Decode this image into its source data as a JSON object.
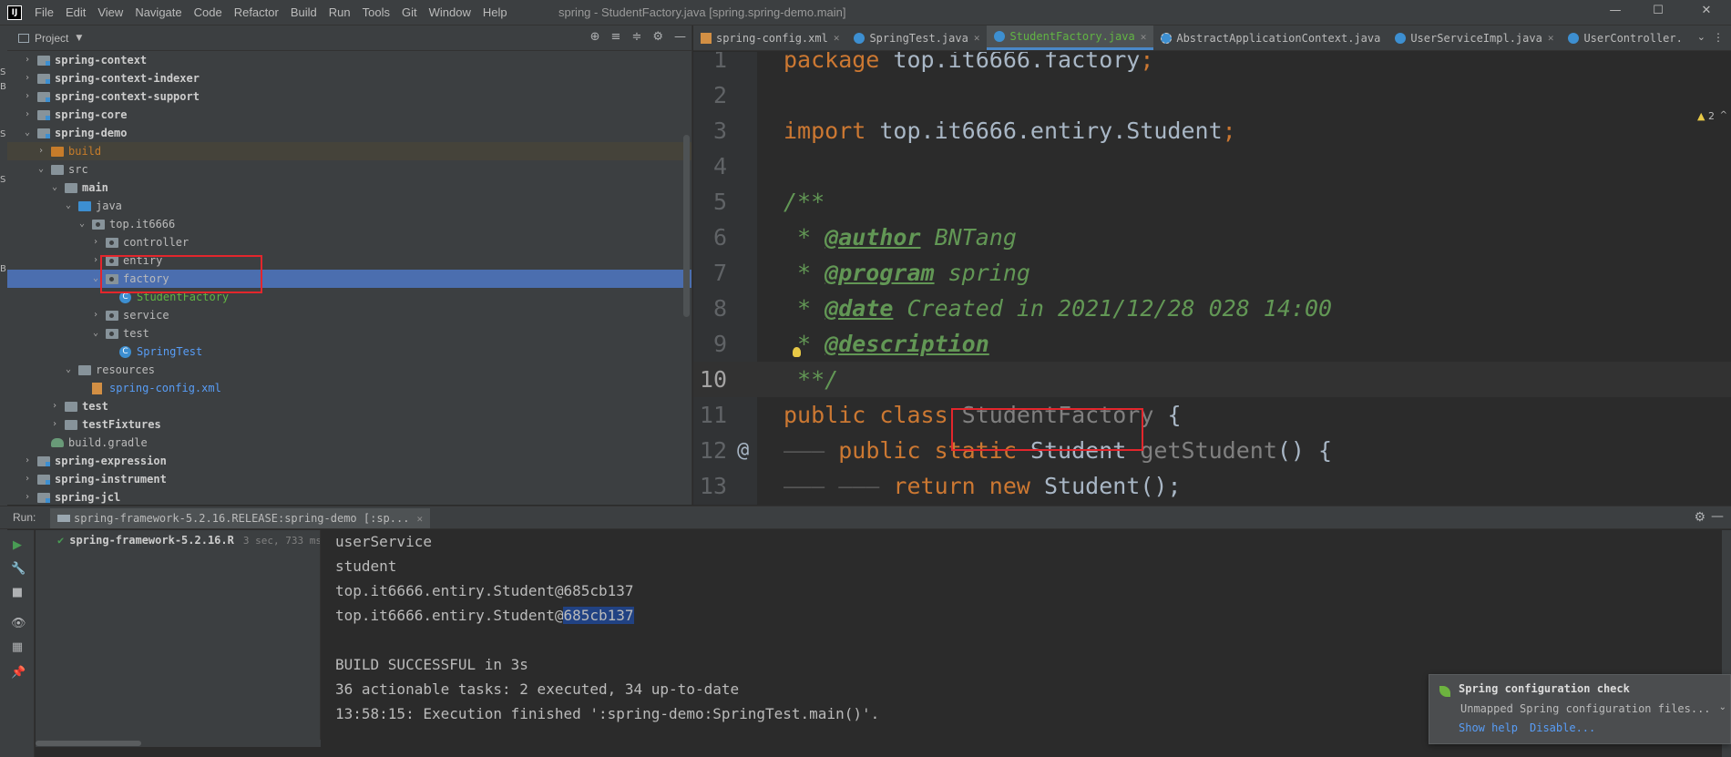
{
  "app": {
    "logo": "IJ",
    "window_title": "spring - StudentFactory.java [spring.spring-demo.main]",
    "controls": {
      "minimize": "—",
      "maximize": "☐",
      "close": "✕"
    }
  },
  "menu": [
    "File",
    "Edit",
    "View",
    "Navigate",
    "Code",
    "Refactor",
    "Build",
    "Run",
    "Tools",
    "Git",
    "Window",
    "Help"
  ],
  "left_strip": [
    "S",
    "B",
    "S",
    "S",
    "B"
  ],
  "project_panel": {
    "title": "Project",
    "tools": [
      "⊕",
      "≡",
      "≑",
      "⚙",
      "—"
    ],
    "tree": [
      {
        "label": "spring-context",
        "depth": 0,
        "arrow": "›",
        "icon": "module",
        "style": "bold"
      },
      {
        "label": "spring-context-indexer",
        "depth": 0,
        "arrow": "›",
        "icon": "module",
        "style": "bold"
      },
      {
        "label": "spring-context-support",
        "depth": 0,
        "arrow": "›",
        "icon": "module",
        "style": "bold"
      },
      {
        "label": "spring-core",
        "depth": 0,
        "arrow": "›",
        "icon": "module",
        "style": "bold"
      },
      {
        "label": "spring-demo",
        "depth": 0,
        "arrow": "⌄",
        "icon": "module",
        "style": "bold"
      },
      {
        "label": "build",
        "depth": 1,
        "arrow": "›",
        "icon": "folder-orange",
        "style": "orange",
        "excluded": true
      },
      {
        "label": "src",
        "depth": 1,
        "arrow": "⌄",
        "icon": "folder",
        "style": "plain"
      },
      {
        "label": "main",
        "depth": 2,
        "arrow": "⌄",
        "icon": "folder",
        "style": "bold"
      },
      {
        "label": "java",
        "depth": 3,
        "arrow": "⌄",
        "icon": "folder-java",
        "style": "plain"
      },
      {
        "label": "top.it6666",
        "depth": 4,
        "arrow": "⌄",
        "icon": "package",
        "style": "plain"
      },
      {
        "label": "controller",
        "depth": 5,
        "arrow": "›",
        "icon": "package",
        "style": "plain"
      },
      {
        "label": "entiry",
        "depth": 5,
        "arrow": "›",
        "icon": "package",
        "style": "plain"
      },
      {
        "label": "factory",
        "depth": 5,
        "arrow": "⌄",
        "icon": "package",
        "style": "plain",
        "selected": true
      },
      {
        "label": "StudentFactory",
        "depth": 6,
        "arrow": "",
        "icon": "class",
        "style": "green"
      },
      {
        "label": "service",
        "depth": 5,
        "arrow": "›",
        "icon": "package",
        "style": "plain"
      },
      {
        "label": "test",
        "depth": 5,
        "arrow": "⌄",
        "icon": "package",
        "style": "plain"
      },
      {
        "label": "SpringTest",
        "depth": 6,
        "arrow": "",
        "icon": "class",
        "style": "blue"
      },
      {
        "label": "resources",
        "depth": 3,
        "arrow": "⌄",
        "icon": "folder-res",
        "style": "plain"
      },
      {
        "label": "spring-config.xml",
        "depth": 4,
        "arrow": "",
        "icon": "xml",
        "style": "blue"
      },
      {
        "label": "test",
        "depth": 2,
        "arrow": "›",
        "icon": "folder",
        "style": "bold"
      },
      {
        "label": "testFixtures",
        "depth": 2,
        "arrow": "›",
        "icon": "folder",
        "style": "bold"
      },
      {
        "label": "build.gradle",
        "depth": 1,
        "arrow": "",
        "icon": "gradle",
        "style": "plain"
      },
      {
        "label": "spring-expression",
        "depth": 0,
        "arrow": "›",
        "icon": "module",
        "style": "bold"
      },
      {
        "label": "spring-instrument",
        "depth": 0,
        "arrow": "›",
        "icon": "module",
        "style": "bold"
      },
      {
        "label": "spring-jcl",
        "depth": 0,
        "arrow": "›",
        "icon": "module",
        "style": "bold"
      }
    ]
  },
  "tabs": [
    {
      "name": "spring-config.xml",
      "icon": "xml",
      "style": "plain"
    },
    {
      "name": "SpringTest.java",
      "icon": "class",
      "style": "plain"
    },
    {
      "name": "StudentFactory.java",
      "icon": "class",
      "style": "active",
      "active": true
    },
    {
      "name": "AbstractApplicationContext.java",
      "icon": "abstract",
      "style": "plain"
    },
    {
      "name": "UserServiceImpl.java",
      "icon": "class",
      "style": "plain"
    },
    {
      "name": "UserController.",
      "icon": "class",
      "style": "plain"
    }
  ],
  "tab_overflow": "⌄",
  "tab_menu": "⋮",
  "editor": {
    "warnings": "2",
    "lines": [
      {
        "n": "1",
        "tokens": [
          [
            "kw",
            "package "
          ],
          [
            "p",
            "top.it6666.factory"
          ],
          [
            "kw",
            ";"
          ]
        ]
      },
      {
        "n": "2",
        "tokens": []
      },
      {
        "n": "3",
        "tokens": [
          [
            "kw",
            "import "
          ],
          [
            "p",
            "top.it6666.entiry.Student"
          ],
          [
            "kw",
            ";"
          ]
        ]
      },
      {
        "n": "4",
        "tokens": []
      },
      {
        "n": "5",
        "tokens": [
          [
            "doc",
            "/**"
          ]
        ]
      },
      {
        "n": "6",
        "tokens": [
          [
            "doc",
            " * "
          ],
          [
            "doctag",
            "@author"
          ],
          [
            "doc",
            " BNTang"
          ]
        ]
      },
      {
        "n": "7",
        "tokens": [
          [
            "doc",
            " * "
          ],
          [
            "doctag",
            "@program"
          ],
          [
            "doc",
            " spring"
          ]
        ]
      },
      {
        "n": "8",
        "tokens": [
          [
            "doc",
            " * "
          ],
          [
            "doctag",
            "@date"
          ],
          [
            "doc",
            " Created in 2021/12/28 028 14:00"
          ]
        ]
      },
      {
        "n": "9",
        "tokens": [
          [
            "doc",
            " * "
          ],
          [
            "doctag",
            "@description"
          ]
        ]
      },
      {
        "n": "10",
        "current": true,
        "tokens": [
          [
            "doc",
            " **/"
          ]
        ]
      },
      {
        "n": "11",
        "tokens": [
          [
            "kw",
            "public class "
          ],
          [
            "unused",
            "StudentFactory"
          ],
          [
            "p",
            " {"
          ]
        ]
      },
      {
        "n": "12",
        "tokens": [
          [
            "ws",
            "——— "
          ],
          [
            "kw",
            "public static "
          ],
          [
            "p",
            "Student "
          ],
          [
            "unused",
            "getStudent"
          ],
          [
            "p",
            "() {"
          ]
        ]
      },
      {
        "n": "13",
        "tokens": [
          [
            "ws",
            "——— ——— "
          ],
          [
            "kw",
            "return new "
          ],
          [
            "p",
            "Student();"
          ]
        ]
      }
    ],
    "at_marker": "@"
  },
  "run": {
    "label": "Run:",
    "tab": "spring-framework-5.2.16.RELEASE:spring-demo [:sp...",
    "tree_item": "spring-framework-5.2.16.R",
    "tree_time": "3 sec, 733 ms",
    "toolbar": [
      "▶",
      "🔧",
      "■",
      "👁",
      "▦",
      "📌"
    ],
    "console": [
      {
        "text": "userService"
      },
      {
        "text": "student"
      },
      {
        "text": "top.it6666.entiry.Student@685cb137"
      },
      {
        "text": "top.it6666.entiry.Student@",
        "highlight": "685cb137"
      },
      {
        "text": ""
      },
      {
        "text": "BUILD SUCCESSFUL in 3s"
      },
      {
        "text": "36 actionable tasks: 2 executed, 34 up-to-date"
      },
      {
        "text": "13:58:15: Execution finished ':spring-demo:SpringTest.main()'."
      }
    ]
  },
  "notification": {
    "title": "Spring configuration check",
    "body": "Unmapped Spring configuration files...",
    "links": [
      "Show help",
      "Disable..."
    ]
  }
}
